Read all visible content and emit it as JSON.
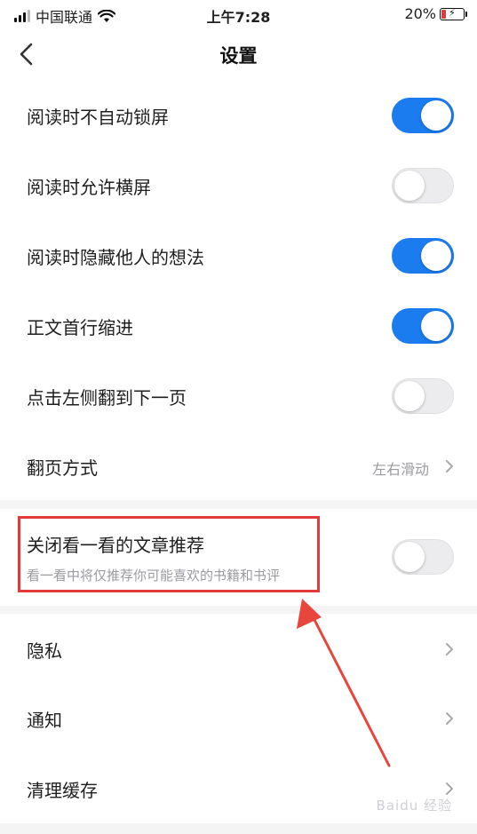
{
  "status_bar": {
    "carrier": "中国联通",
    "time": "上午7:28",
    "battery": "20%"
  },
  "nav": {
    "title": "设置"
  },
  "reading_settings": [
    {
      "label": "阅读时不自动锁屏",
      "toggle": true
    },
    {
      "label": "阅读时允许横屏",
      "toggle": false
    },
    {
      "label": "阅读时隐藏他人的想法",
      "toggle": true
    },
    {
      "label": "正文首行缩进",
      "toggle": true
    },
    {
      "label": "点击左侧翻到下一页",
      "toggle": false
    }
  ],
  "page_turn": {
    "label": "翻页方式",
    "value": "左右滑动"
  },
  "recommend": {
    "label": "关闭看一看的文章推荐",
    "subtitle": "看一看中将仅推荐你可能喜欢的书籍和书评",
    "toggle": false
  },
  "more": [
    {
      "label": "隐私"
    },
    {
      "label": "通知"
    },
    {
      "label": "清理缓存"
    }
  ],
  "colors": {
    "accent": "#1b7cf0",
    "annotation": "#e03a3a"
  }
}
